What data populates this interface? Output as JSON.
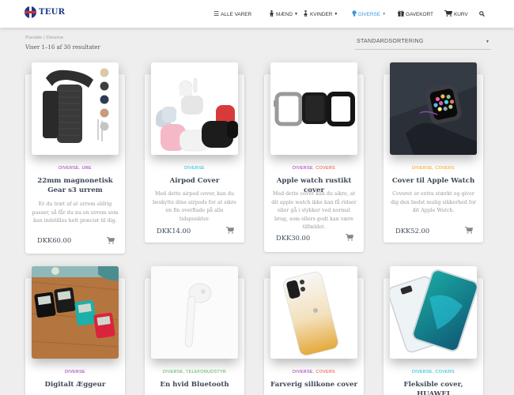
{
  "brand": {
    "name": "TEUR"
  },
  "nav": {
    "items": [
      {
        "label": "ALLE VARER",
        "icon": "list-icon"
      },
      {
        "label": "MÆND",
        "icon": "man-icon"
      },
      {
        "label": "KVINDER",
        "icon": "woman-icon"
      },
      {
        "label": "DIVERSE",
        "icon": "bulb-icon",
        "active": true
      },
      {
        "label": "GAVEKORT",
        "icon": "gift-icon"
      },
      {
        "label": "KURV",
        "icon": "cart-icon"
      }
    ],
    "search_icon": "search-icon",
    "active_color": "#3b9ae1"
  },
  "shop": {
    "breadcrumb": "Forside / Diverse",
    "result_count": "Viser 1–16 af 30 resultater",
    "sort_value": "STANDARDSORTERING"
  },
  "products": [
    {
      "categories": [
        {
          "name": "DIVERSE",
          "color": "#9c27b0"
        },
        {
          "name": "URE",
          "color": "#9c27b0"
        }
      ],
      "title": "22mm magnonetisk Gear s3 urrem",
      "description": "Er du træt af at urrem aldrig passer, så får du nu en urrem som kan indstilles helt præcist til dig.",
      "price": "DKK60.00"
    },
    {
      "categories": [
        {
          "name": "DIVERSE",
          "color": "#00bcd4"
        }
      ],
      "title": "Airpod Cover",
      "description": "Med dette airpod cover, kan du beskytte dine airpods for at sikre en fin overflade på alle tidspunkter.",
      "price": "DKK14.00"
    },
    {
      "categories": [
        {
          "name": "DIVERSE",
          "color": "#9c27b0"
        },
        {
          "name": "COVERS",
          "color": "#f44336"
        }
      ],
      "title": "Apple watch rustikt cover",
      "description": "Med dette cover kan du sikre, at dit apple watch ikke kan få ridser eller gå i stykker ved normal brug, som ellers godt kan være tilfældet.",
      "price": "DKK30.00"
    },
    {
      "categories": [
        {
          "name": "DIVERSE",
          "color": "#ff9800"
        },
        {
          "name": "COVERS",
          "color": "#ff9800"
        }
      ],
      "title": "Cover til Apple Watch",
      "description": "Coveret er extra stærkt og giver dig den bedst mulig sikkerhed for dit Apple Watch.",
      "price": "DKK52.00"
    },
    {
      "categories": [
        {
          "name": "DIVERSE",
          "color": "#9c27b0"
        }
      ],
      "title": "Digitalt Æggeur"
    },
    {
      "categories": [
        {
          "name": "DIVERSE",
          "color": "#4caf50"
        },
        {
          "name": "TELEFONUDSTYR",
          "color": "#4caf50"
        }
      ],
      "title": "En hvid Bluetooth"
    },
    {
      "categories": [
        {
          "name": "DIVERSE",
          "color": "#9c27b0"
        },
        {
          "name": "COVERS",
          "color": "#f44336"
        }
      ],
      "title": "Farverig silikone cover"
    },
    {
      "categories": [
        {
          "name": "DIVERSE",
          "color": "#00bcd4"
        },
        {
          "name": "COVERS",
          "color": "#00bcd4"
        }
      ],
      "title": "Fleksible cover, HUAWEI"
    }
  ]
}
